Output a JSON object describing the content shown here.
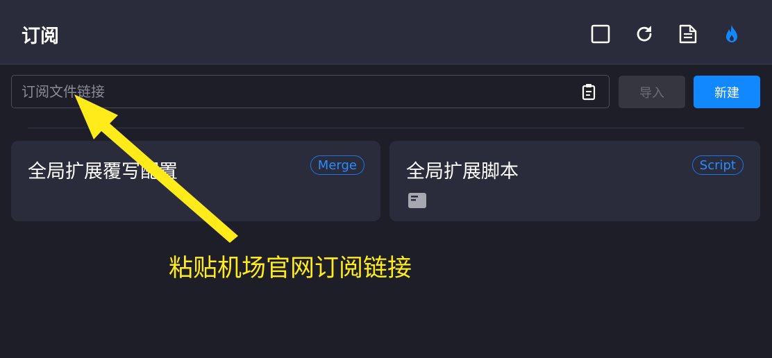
{
  "header": {
    "title": "订阅",
    "icons": [
      "stop-square-icon",
      "refresh-icon",
      "file-text-icon",
      "fire-icon"
    ]
  },
  "subscription": {
    "placeholder": "订阅文件链接",
    "value": "",
    "paste_icon": "clipboard-icon",
    "import_label": "导入",
    "new_label": "新建"
  },
  "cards": [
    {
      "title": "全局扩展覆写配置",
      "badge": "Merge"
    },
    {
      "title": "全局扩展脚本",
      "badge": "Script",
      "icon": "script-file-icon"
    }
  ],
  "annotation": {
    "text": "粘贴机场官网订阅链接"
  },
  "colors": {
    "accent": "#1188ff",
    "annotation": "#ffeb1a",
    "background": "#1e1e28",
    "panel": "#2a2c3b"
  }
}
